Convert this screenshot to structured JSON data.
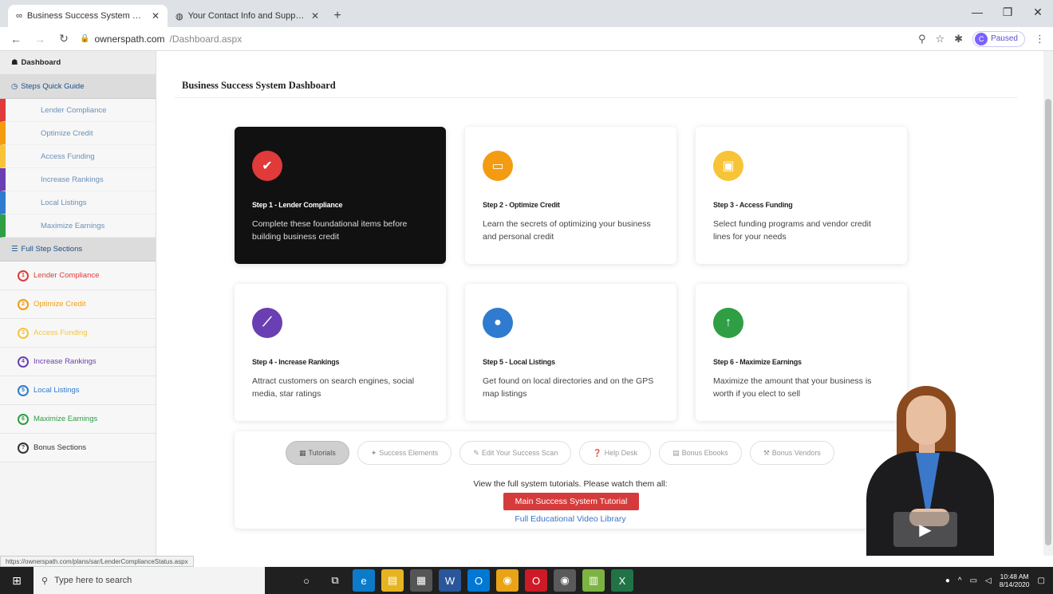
{
  "browser": {
    "tabs": [
      {
        "title": "Business Success System Dashbo",
        "icon": "infinity-icon",
        "active": true
      },
      {
        "title": "Your Contact Info and Support :",
        "icon": "globe-icon",
        "active": false
      }
    ],
    "url_host": "ownerspath.com",
    "url_path": "/Dashboard.aspx",
    "profile_initial": "C",
    "profile_label": "Paused"
  },
  "sidebar": {
    "dashboard_label": "Dashboard",
    "quick_guide_label": "Steps Quick Guide",
    "quick_items": [
      {
        "label": "Lender Compliance",
        "color": "#e03a3a"
      },
      {
        "label": "Optimize Credit",
        "color": "#f39c12"
      },
      {
        "label": "Access Funding",
        "color": "#f7c438"
      },
      {
        "label": "Increase Rankings",
        "color": "#6a3fb3"
      },
      {
        "label": "Local Listings",
        "color": "#2e7bcf"
      },
      {
        "label": "Maximize Earnings",
        "color": "#2f9e44"
      }
    ],
    "full_sections_label": "Full Step Sections",
    "steps": [
      {
        "label": "Lender Compliance",
        "number": "1",
        "color": "#e03a3a"
      },
      {
        "label": "Optimize Credit",
        "number": "2",
        "color": "#f39c12"
      },
      {
        "label": "Access Funding",
        "number": "3",
        "color": "#f7c438"
      },
      {
        "label": "Increase Rankings",
        "number": "4",
        "color": "#6a3fb3"
      },
      {
        "label": "Local Listings",
        "number": "5",
        "color": "#2e7bcf"
      },
      {
        "label": "Maximize Earnings",
        "number": "6",
        "color": "#2f9e44"
      },
      {
        "label": "Bonus Sections",
        "number": "?",
        "color": "#333333"
      }
    ]
  },
  "main": {
    "title": "Business Success System Dashboard",
    "cards": [
      {
        "title": "Step 1 - Lender Compliance",
        "desc": "Complete these foundational items before building business credit",
        "icon": "check-icon",
        "glyph": "✔",
        "color": "#e03a3a",
        "dark": true
      },
      {
        "title": "Step 2 - Optimize Credit",
        "desc": "Learn the secrets of optimizing your business and personal credit",
        "icon": "credit-card-icon",
        "glyph": "▭",
        "color": "#f39c12",
        "dark": false
      },
      {
        "title": "Step 3 - Access Funding",
        "desc": "Select funding programs and vendor credit lines for your needs",
        "icon": "money-icon",
        "glyph": "▣",
        "color": "#f7c438",
        "dark": false
      },
      {
        "title": "Step 4 - Increase Rankings",
        "desc": "Attract customers on search engines, social media, star ratings",
        "icon": "trending-up-icon",
        "glyph": "⟋",
        "color": "#6a3fb3",
        "dark": false
      },
      {
        "title": "Step 5 - Local Listings",
        "desc": "Get found on local directories and on the GPS map listings",
        "icon": "map-pin-icon",
        "glyph": "●",
        "color": "#2e7bcf",
        "dark": false
      },
      {
        "title": "Step 6 - Maximize Earnings",
        "desc": "Maximize the amount that your business is worth if you elect to sell",
        "icon": "arrow-up-icon",
        "glyph": "↑",
        "color": "#2f9e44",
        "dark": false
      }
    ],
    "panel": {
      "tabs": [
        {
          "label": "Tutorials",
          "icon": "grid-icon",
          "active": true
        },
        {
          "label": "Success Elements",
          "icon": "star-icon",
          "active": false
        },
        {
          "label": "Edit Your Success Scan",
          "icon": "pencil-icon",
          "active": false
        },
        {
          "label": "Help Desk",
          "icon": "help-icon",
          "active": false
        },
        {
          "label": "Bonus Ebooks",
          "icon": "book-icon",
          "active": false
        },
        {
          "label": "Bonus Vendors",
          "icon": "wrench-icon",
          "active": false
        }
      ],
      "text": "View the full system tutorials. Please watch them all:",
      "button_label": "Main Success System Tutorial",
      "link_label": "Full Educational Video Library"
    }
  },
  "status_url": "https://ownerspath.com/plans/sar/LenderComplianceStatus.aspx",
  "taskbar": {
    "search_placeholder": "Type here to search",
    "time": "10:48 AM",
    "date": "8/14/2020"
  }
}
